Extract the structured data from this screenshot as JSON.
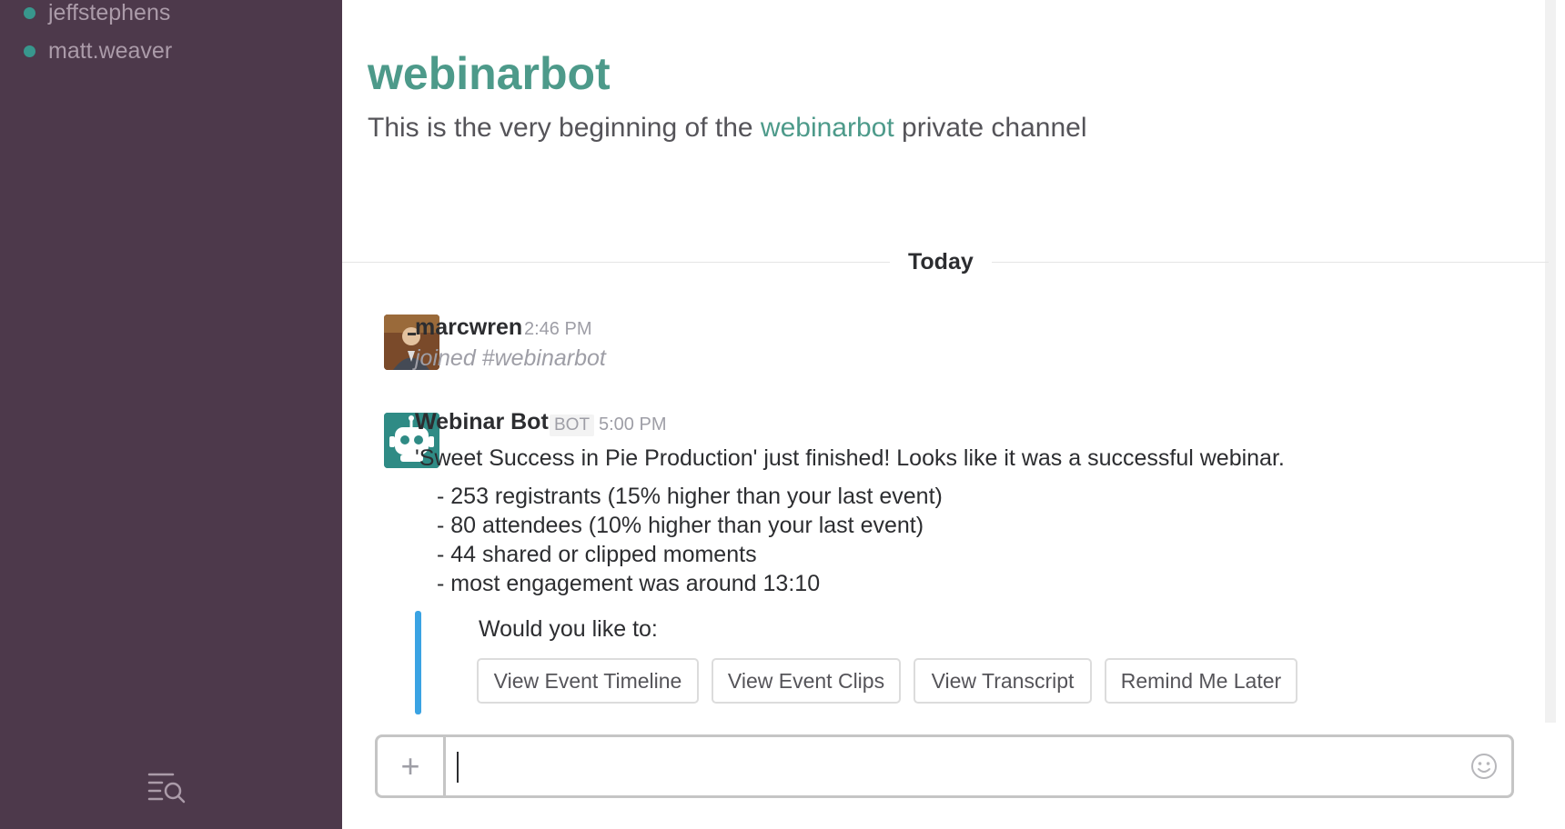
{
  "sidebar": {
    "direct_messages": [
      {
        "name": "jeffstephens",
        "status": "online"
      },
      {
        "name": "matt.weaver",
        "status": "online"
      }
    ],
    "footer_icon": "search-list-icon"
  },
  "channel": {
    "title": "webinarbot",
    "intro_prefix": "This is the very beginning of the ",
    "intro_link": "webinarbot",
    "intro_suffix": " private channel"
  },
  "day_divider": "Today",
  "messages": [
    {
      "author": "marcwren",
      "time": "2:46 PM",
      "text": "joined #webinarbot",
      "avatar": "user-photo"
    },
    {
      "author": "Webinar Bot",
      "badge": "BOT",
      "time": "5:00 PM",
      "avatar": "robot-icon",
      "text": "'Sweet Success in Pie Production' just finished! Looks like it was a successful webinar.",
      "stats": [
        "- 253 registrants (15% higher than your last event)",
        "- 80 attendees (10% higher than your last event)",
        "- 44 shared or clipped moments",
        "- most engagement was around 13:10"
      ],
      "attachment": {
        "prompt": "Would you like to:",
        "accent_color": "#3aa3e3",
        "actions": [
          "View Event Timeline",
          "View Event Clips",
          "View Transcript",
          "Remind Me Later"
        ]
      }
    }
  ],
  "composer": {
    "plus_label": "+",
    "value": "",
    "emoji_icon": "smiley-icon"
  },
  "colors": {
    "sidebar_bg": "#4d394b",
    "brand_green": "#4d9a8a",
    "online_dot": "#38978d"
  }
}
